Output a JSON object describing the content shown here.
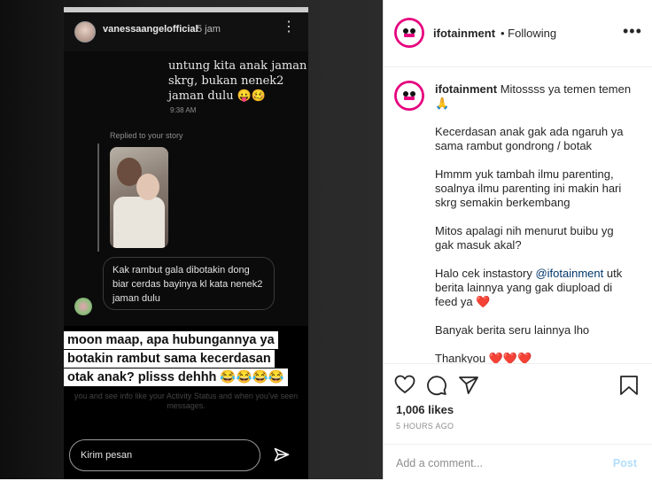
{
  "story": {
    "username": "vanessaangelofficial",
    "time": "5 jam",
    "dm_text": "untung kita anak jaman skrg, bukan nenek2 jaman dulu 😛🥴",
    "dm_time": "9:38 AM",
    "replied_label": "Replied to your story",
    "reply_text": "Kak rambut gala dibotakin dong biar cerdas bayinya kl kata nenek2 jaman dulu",
    "caption_lines": [
      "moon maap, apa hubungannya ya",
      "botakin rambut sama kecerdasan",
      "otak anak? plisss dehhh 😂😂😂😂"
    ],
    "hint_text": "you and see info like your Activity Status and when you've seen messages.",
    "input_placeholder": "Kirim pesan"
  },
  "post": {
    "username": "ifotainment",
    "follow_status": "Following",
    "caption_paragraphs": [
      "Mitossss ya temen temen 🙏",
      "Kecerdasan anak gak ada ngaruh ya sama rambut gondrong / botak",
      "Hmmm yuk tambah ilmu parenting, soalnya ilmu parenting ini makin hari skrg semakin berkembang",
      "Mitos apalagi nih menurut buibu yg gak masuk akal?",
      "Banyak berita seru lainnya lho",
      "Thankyou ❤️❤️❤️"
    ],
    "mention_pre": "Halo cek instastory ",
    "mention": "@ifotainment",
    "mention_post": " utk berita lainnya yang gak diupload di feed ya ❤️",
    "likes": "1,006 likes",
    "time_ago": "5 HOURS AGO",
    "comment_placeholder": "Add a comment...",
    "post_label": "Post"
  },
  "colors": {
    "link": "#00376b",
    "post_button": "#b2dffc",
    "story_bg": "#000000"
  }
}
